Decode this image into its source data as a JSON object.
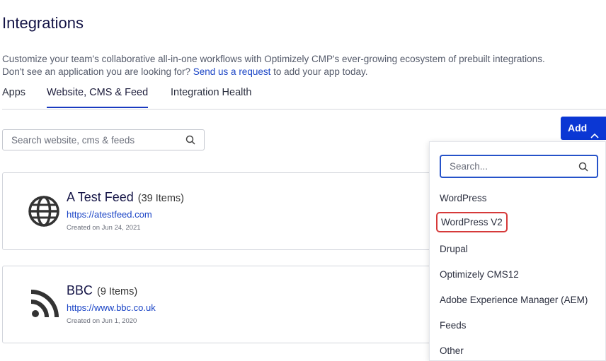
{
  "header": {
    "title": "Integrations",
    "description_line1": "Customize your team's collaborative all-in-one workflows with Optimizely CMP's ever-growing ecosystem of prebuilt integrations.",
    "description_line2_prefix": "Don't see an application you are looking for?",
    "description_link": "Send us a request",
    "description_line2_suffix": "to add your app today."
  },
  "tabs": [
    {
      "label": "Apps",
      "active": false
    },
    {
      "label": "Website, CMS & Feed",
      "active": true
    },
    {
      "label": "Integration Health",
      "active": false
    }
  ],
  "search": {
    "placeholder": "Search website, cms & feeds",
    "icon": "search-icon"
  },
  "cards": [
    {
      "name": "A Test Feed",
      "count": "(39 Items)",
      "url": "https://atestfeed.com",
      "created": "Created on Jun 24, 2021",
      "icon": "globe-icon"
    },
    {
      "name": "BBC",
      "count": "(9 Items)",
      "url": "https://www.bbc.co.uk",
      "created": "Created on Jun 1, 2020",
      "icon": "rss-icon"
    }
  ],
  "add_button": {
    "label": "Add",
    "icon": "chevron-up-icon",
    "color": "#0b37d4"
  },
  "dropdown": {
    "search_placeholder": "Search...",
    "items": [
      "WordPress",
      "WordPress V2",
      "Drupal",
      "Optimizely CMS12",
      "Adobe Experience Manager (AEM)",
      "Feeds",
      "Other"
    ],
    "highlighted_item": "WordPress V2"
  },
  "colors": {
    "accent": "#0b37d4",
    "link": "#1a44c6",
    "highlight_border": "#d63a3a"
  }
}
